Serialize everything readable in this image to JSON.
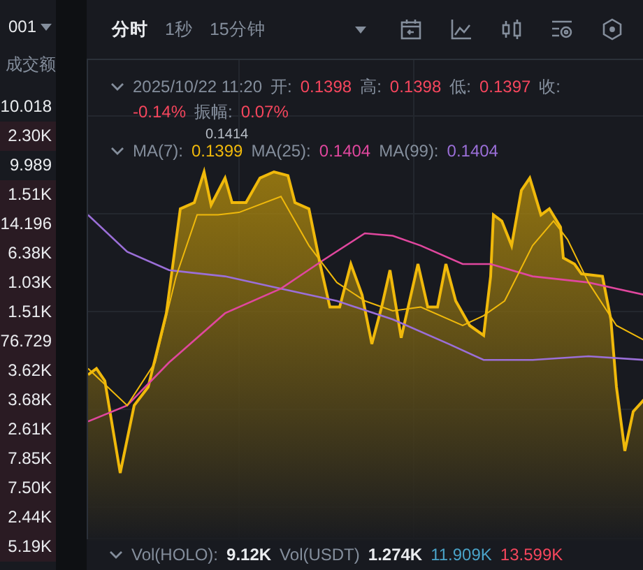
{
  "left_panel": {
    "symbol": "001",
    "column_header": "成交额",
    "rows": [
      {
        "value": "10.018",
        "highlighted": false
      },
      {
        "value": "2.30K",
        "highlighted": true
      },
      {
        "value": "9.989",
        "highlighted": false
      },
      {
        "value": "1.51K",
        "highlighted": true
      },
      {
        "value": "14.196",
        "highlighted": true
      },
      {
        "value": "6.38K",
        "highlighted": true
      },
      {
        "value": "1.03K",
        "highlighted": true
      },
      {
        "value": "1.51K",
        "highlighted": true
      },
      {
        "value": "76.729",
        "highlighted": true
      },
      {
        "value": "3.62K",
        "highlighted": true
      },
      {
        "value": "3.68K",
        "highlighted": true
      },
      {
        "value": "2.61K",
        "highlighted": true
      },
      {
        "value": "7.85K",
        "highlighted": true
      },
      {
        "value": "7.50K",
        "highlighted": true
      },
      {
        "value": "2.44K",
        "highlighted": true
      },
      {
        "value": "5.19K",
        "highlighted": true
      }
    ]
  },
  "toolbar": {
    "tabs": [
      {
        "label": "分时",
        "selected": true
      },
      {
        "label": "1秒",
        "selected": false
      },
      {
        "label": "15分钟",
        "selected": false
      }
    ]
  },
  "info": {
    "datetime": "2025/10/22 11:20",
    "fields": [
      {
        "label": "开:",
        "value": "0.1398"
      },
      {
        "label": "高:",
        "value": "0.1398"
      },
      {
        "label": "低:",
        "value": "0.1397"
      },
      {
        "label": "收:"
      }
    ],
    "change": "-0.14%",
    "amplitude_label": "振幅:",
    "amplitude": "0.07%"
  },
  "price_label": "0.1414",
  "ma": [
    {
      "label": "MA(7):",
      "value": "0.1399",
      "color": "#f0b90b"
    },
    {
      "label": "MA(25):",
      "value": "0.1404",
      "color": "#e0479e"
    },
    {
      "label": "MA(99):",
      "value": "0.1404",
      "color": "#9b6fd8"
    }
  ],
  "volume": {
    "label": "Vol(HOLO):",
    "value": "9.12K",
    "label2": "Vol(USDT)",
    "value2": "1.274K",
    "extra": [
      {
        "value": "11.909K",
        "color": "#4aa3c8"
      },
      {
        "value": "13.599K",
        "color": "#f6465d"
      }
    ]
  }
}
